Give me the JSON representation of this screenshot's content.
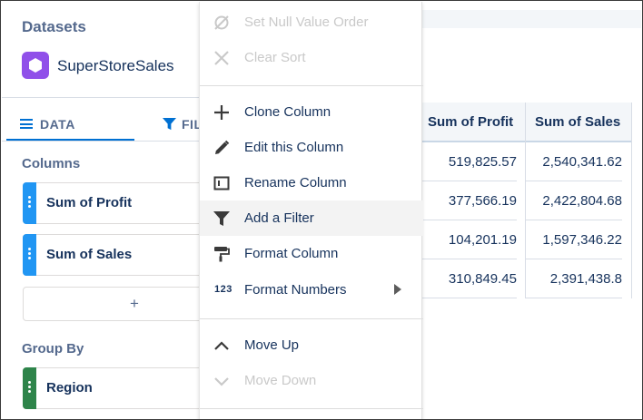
{
  "left_panel": {
    "datasets_title": "Datasets",
    "dataset_name": "SuperStoreSales",
    "tabs": [
      {
        "label": "DATA",
        "active": true
      },
      {
        "label": "FIL",
        "active": false
      }
    ],
    "columns_title": "Columns",
    "columns": [
      {
        "label": "Sum of Profit",
        "color": "#2196f3"
      },
      {
        "label": "Sum of Sales",
        "color": "#2196f3"
      }
    ],
    "add_label": "+",
    "group_by_title": "Group By",
    "group_by": [
      {
        "label": "Region",
        "color": "#2e844a"
      }
    ]
  },
  "context_menu": {
    "items": [
      {
        "label": "Set Null Value Order",
        "icon": "null-icon",
        "disabled": true
      },
      {
        "label": "Clear Sort",
        "icon": "close-icon",
        "disabled": true
      },
      {
        "label": "Clone Column",
        "icon": "plus-icon",
        "disabled": false
      },
      {
        "label": "Edit this Column",
        "icon": "pencil-icon",
        "disabled": false
      },
      {
        "label": "Rename Column",
        "icon": "rename-icon",
        "disabled": false
      },
      {
        "label": "Add a Filter",
        "icon": "filter-icon",
        "disabled": false,
        "highlighted": true
      },
      {
        "label": "Format Column",
        "icon": "paint-roller-icon",
        "disabled": false
      },
      {
        "label": "Format Numbers",
        "icon": "number-format-icon",
        "icon_text": "123",
        "disabled": false,
        "has_submenu": true
      },
      {
        "label": "Move Up",
        "icon": "chevron-up-icon",
        "disabled": false
      },
      {
        "label": "Move Down",
        "icon": "chevron-down-icon",
        "disabled": true
      }
    ]
  },
  "table": {
    "headers": [
      "Sum of Profit",
      "Sum of Sales"
    ],
    "rows": [
      [
        "519,825.57",
        "2,540,341.62"
      ],
      [
        "377,566.19",
        "2,422,804.68"
      ],
      [
        "104,201.19",
        "1,597,346.22"
      ],
      [
        "310,849.45",
        "2,391,438.8"
      ]
    ]
  },
  "colors": {
    "accent": "#0070d2",
    "text": "#16325c",
    "muted": "#54698d",
    "dataset_icon": "#9050e9"
  }
}
